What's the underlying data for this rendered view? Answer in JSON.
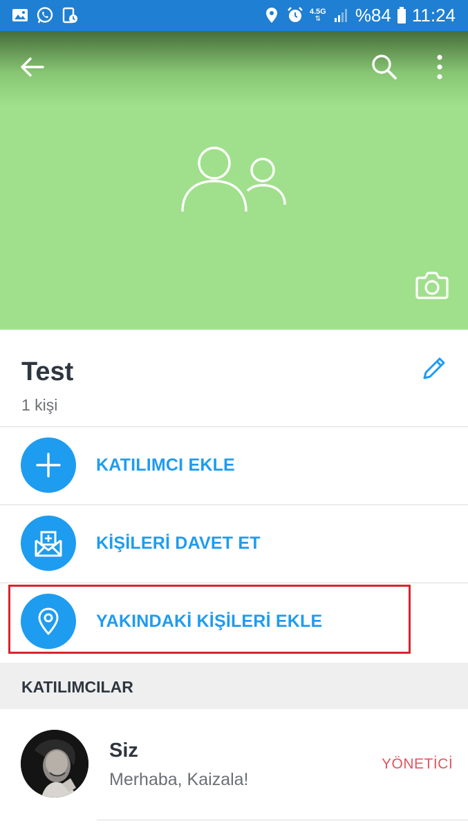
{
  "status_bar": {
    "net_label": "4.5G",
    "battery": "%84",
    "time": "11:24",
    "left_icons": [
      "gallery-icon",
      "whatsapp-icon",
      "screen-record-icon"
    ],
    "right_icons": [
      "location-icon",
      "alarm-icon",
      "signal-icon",
      "battery-icon"
    ]
  },
  "header": {
    "back_icon": "arrow-left-icon",
    "search_icon": "search-icon",
    "more_icon": "more-vertical-icon",
    "avatar_icon": "group-icon",
    "camera_icon": "camera-icon",
    "background_color": "#a0e08c"
  },
  "group": {
    "name": "Test",
    "member_count": "1 kişi",
    "edit_icon": "pencil-icon"
  },
  "actions": [
    {
      "label": "KATILIMCI EKLE",
      "icon": "plus-icon"
    },
    {
      "label": "KİŞİLERİ DAVET ET",
      "icon": "mail-invite-icon"
    },
    {
      "label": "YAKINDAKİ KİŞİLERİ EKLE",
      "icon": "location-pin-icon"
    }
  ],
  "participants_section": {
    "title": "KATILIMCILAR"
  },
  "members": [
    {
      "name": "Siz",
      "status": "Merhaba, Kaizala!",
      "role": "YÖNETİCİ"
    }
  ],
  "colors": {
    "accent": "#1e9cf0",
    "status_bar": "#1f7fd2",
    "role": "#e0555f",
    "highlight": "#d9232e"
  }
}
